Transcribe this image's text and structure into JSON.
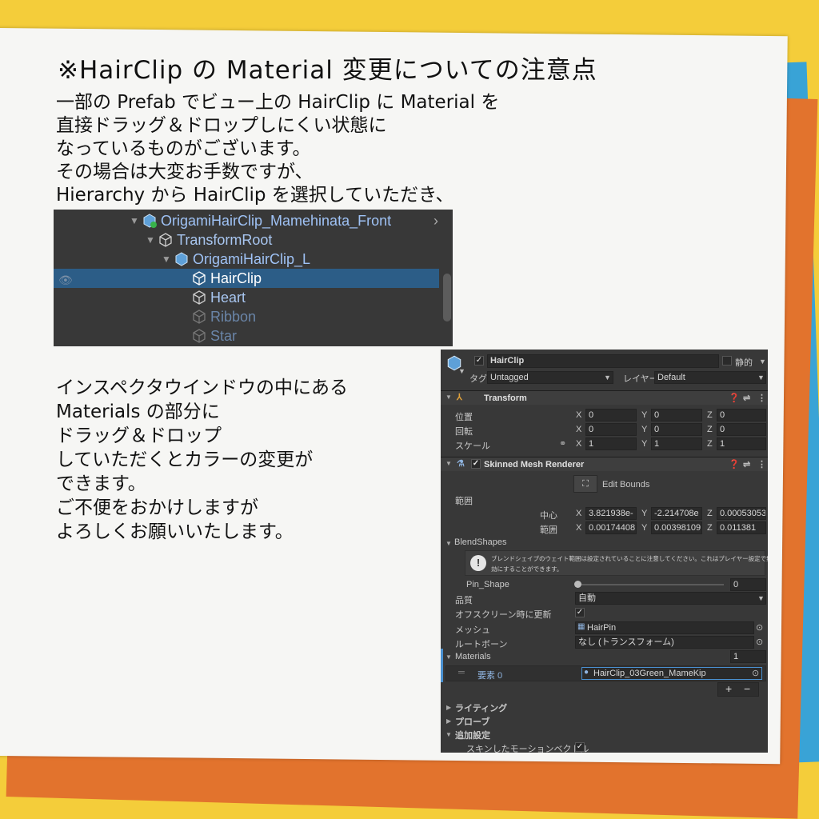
{
  "title": "※HairClip の Material 変更についての注意点",
  "intro_lines": [
    "一部の Prefab でビュー上の HairClip に Material を",
    "直接ドラッグ＆ドロップしにくい状態に",
    "なっているものがございます。",
    "その場合は大変お手数ですが、",
    "Hierarchy から HairClip を選択していただき、"
  ],
  "instruction_lines": [
    "インスペクタウインドウの中にある",
    "Materials の部分に",
    "ドラッグ＆ドロップ",
    "していただくとカラーの変更が",
    "できます。",
    "ご不便をおかけしますが",
    "よろしくお願いいたします。"
  ],
  "hierarchy": {
    "items": [
      {
        "label": "OrigamiHairClip_Mamehinata_Front"
      },
      {
        "label": "TransformRoot"
      },
      {
        "label": "OrigamiHairClip_L"
      },
      {
        "label": "HairClip"
      },
      {
        "label": "Heart"
      },
      {
        "label": "Ribbon"
      },
      {
        "label": "Star"
      }
    ]
  },
  "inspector": {
    "object_name": "HairClip",
    "static_label": "静的",
    "tag_label": "タグ",
    "tag_value": "Untagged",
    "layer_label": "レイヤー",
    "layer_value": "Default",
    "transform": {
      "header": "Transform",
      "position_label": "位置",
      "rotation_label": "回転",
      "scale_label": "スケール",
      "position": [
        "0",
        "0",
        "0"
      ],
      "rotation": [
        "0",
        "0",
        "0"
      ],
      "scale": [
        "1",
        "1",
        "1"
      ]
    },
    "axis": [
      "X",
      "Y",
      "Z"
    ],
    "smr": {
      "header": "Skinned Mesh Renderer",
      "edit_bounds": "Edit Bounds",
      "bounds_label": "範囲",
      "center_label": "中心",
      "extent_label": "範囲",
      "center": [
        "3.821938e-",
        "-2.214708e",
        "0.00053053"
      ],
      "extent": [
        "0.00174408",
        "0.00398109",
        "0.011381"
      ],
      "blendshapes_label": "BlendShapes",
      "warning_line1": "ブレンドシェイプのウェイト範囲は設定されていることに注意してください。これはプレイヤー設定で無",
      "warning_line2": "効にすることができます。",
      "pin_shape_label": "Pin_Shape",
      "pin_shape_value": "0",
      "quality_label": "品質",
      "quality_value": "自動",
      "offscreen_label": "オフスクリーン時に更新",
      "mesh_label": "メッシュ",
      "mesh_value": "HairPin",
      "rootbone_label": "ルートボーン",
      "rootbone_value": "なし (トランスフォーム)",
      "materials_label": "Materials",
      "materials_count": "1",
      "element_label": "要素 0",
      "element_value": "HairClip_03Green_MameKip",
      "plus": "+",
      "minus": "−",
      "lighting_label": "ライティング",
      "probe_label": "プローブ",
      "additional_label": "追加設定",
      "skinned_motion_label": "スキンしたモーションベクトル"
    }
  },
  "colors": {
    "background_yellow": "#f4cd3a",
    "blue_paper": "#39a3d6",
    "orange_paper": "#e2732d",
    "selection": "#2c5d87",
    "hierarchy_text": "#9fc2f5"
  }
}
